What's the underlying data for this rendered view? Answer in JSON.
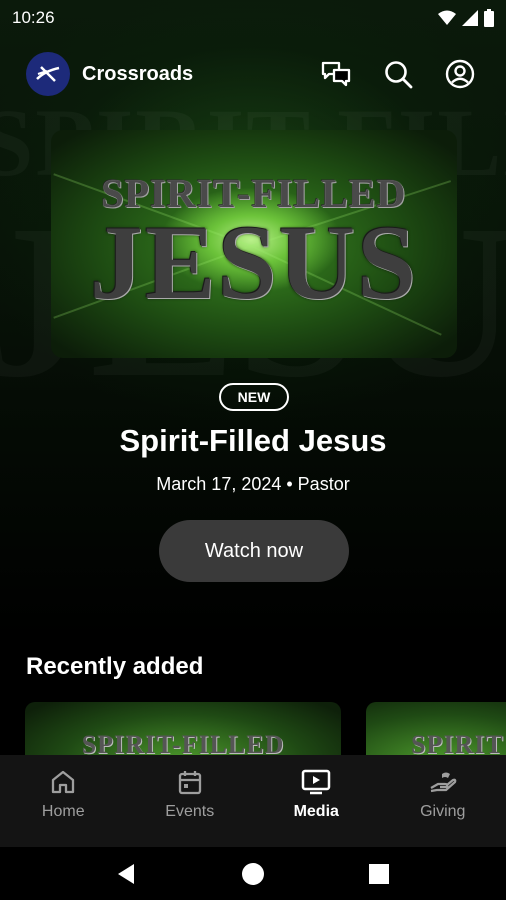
{
  "status_bar": {
    "time": "10:26"
  },
  "app_bar": {
    "title": "Crossroads"
  },
  "background_art": {
    "line1": "SPIRIT-FILLED",
    "line2": "JESUS"
  },
  "hero": {
    "art_line1": "SPIRIT-FILLED",
    "art_line2": "JESUS",
    "badge": "NEW",
    "title": "Spirit-Filled Jesus",
    "meta": "March 17, 2024 • Pastor",
    "cta_label": "Watch now"
  },
  "recent": {
    "title": "Recently added",
    "items": [
      {
        "art_text": "SPIRIT-FILLED"
      },
      {
        "art_text": "SPIRIT"
      }
    ]
  },
  "bottom_nav": {
    "items": [
      {
        "label": "Home",
        "icon": "home-icon"
      },
      {
        "label": "Events",
        "icon": "calendar-icon"
      },
      {
        "label": "Media",
        "icon": "tv-play-icon",
        "active": true
      },
      {
        "label": "Giving",
        "icon": "giving-hand-icon"
      }
    ]
  },
  "colors": {
    "background": "#000000",
    "accent_green": "#6cc33a",
    "button_bg": "#3a3a3a",
    "nav_bg": "#141414",
    "logo_bg": "#1d2a7a"
  }
}
